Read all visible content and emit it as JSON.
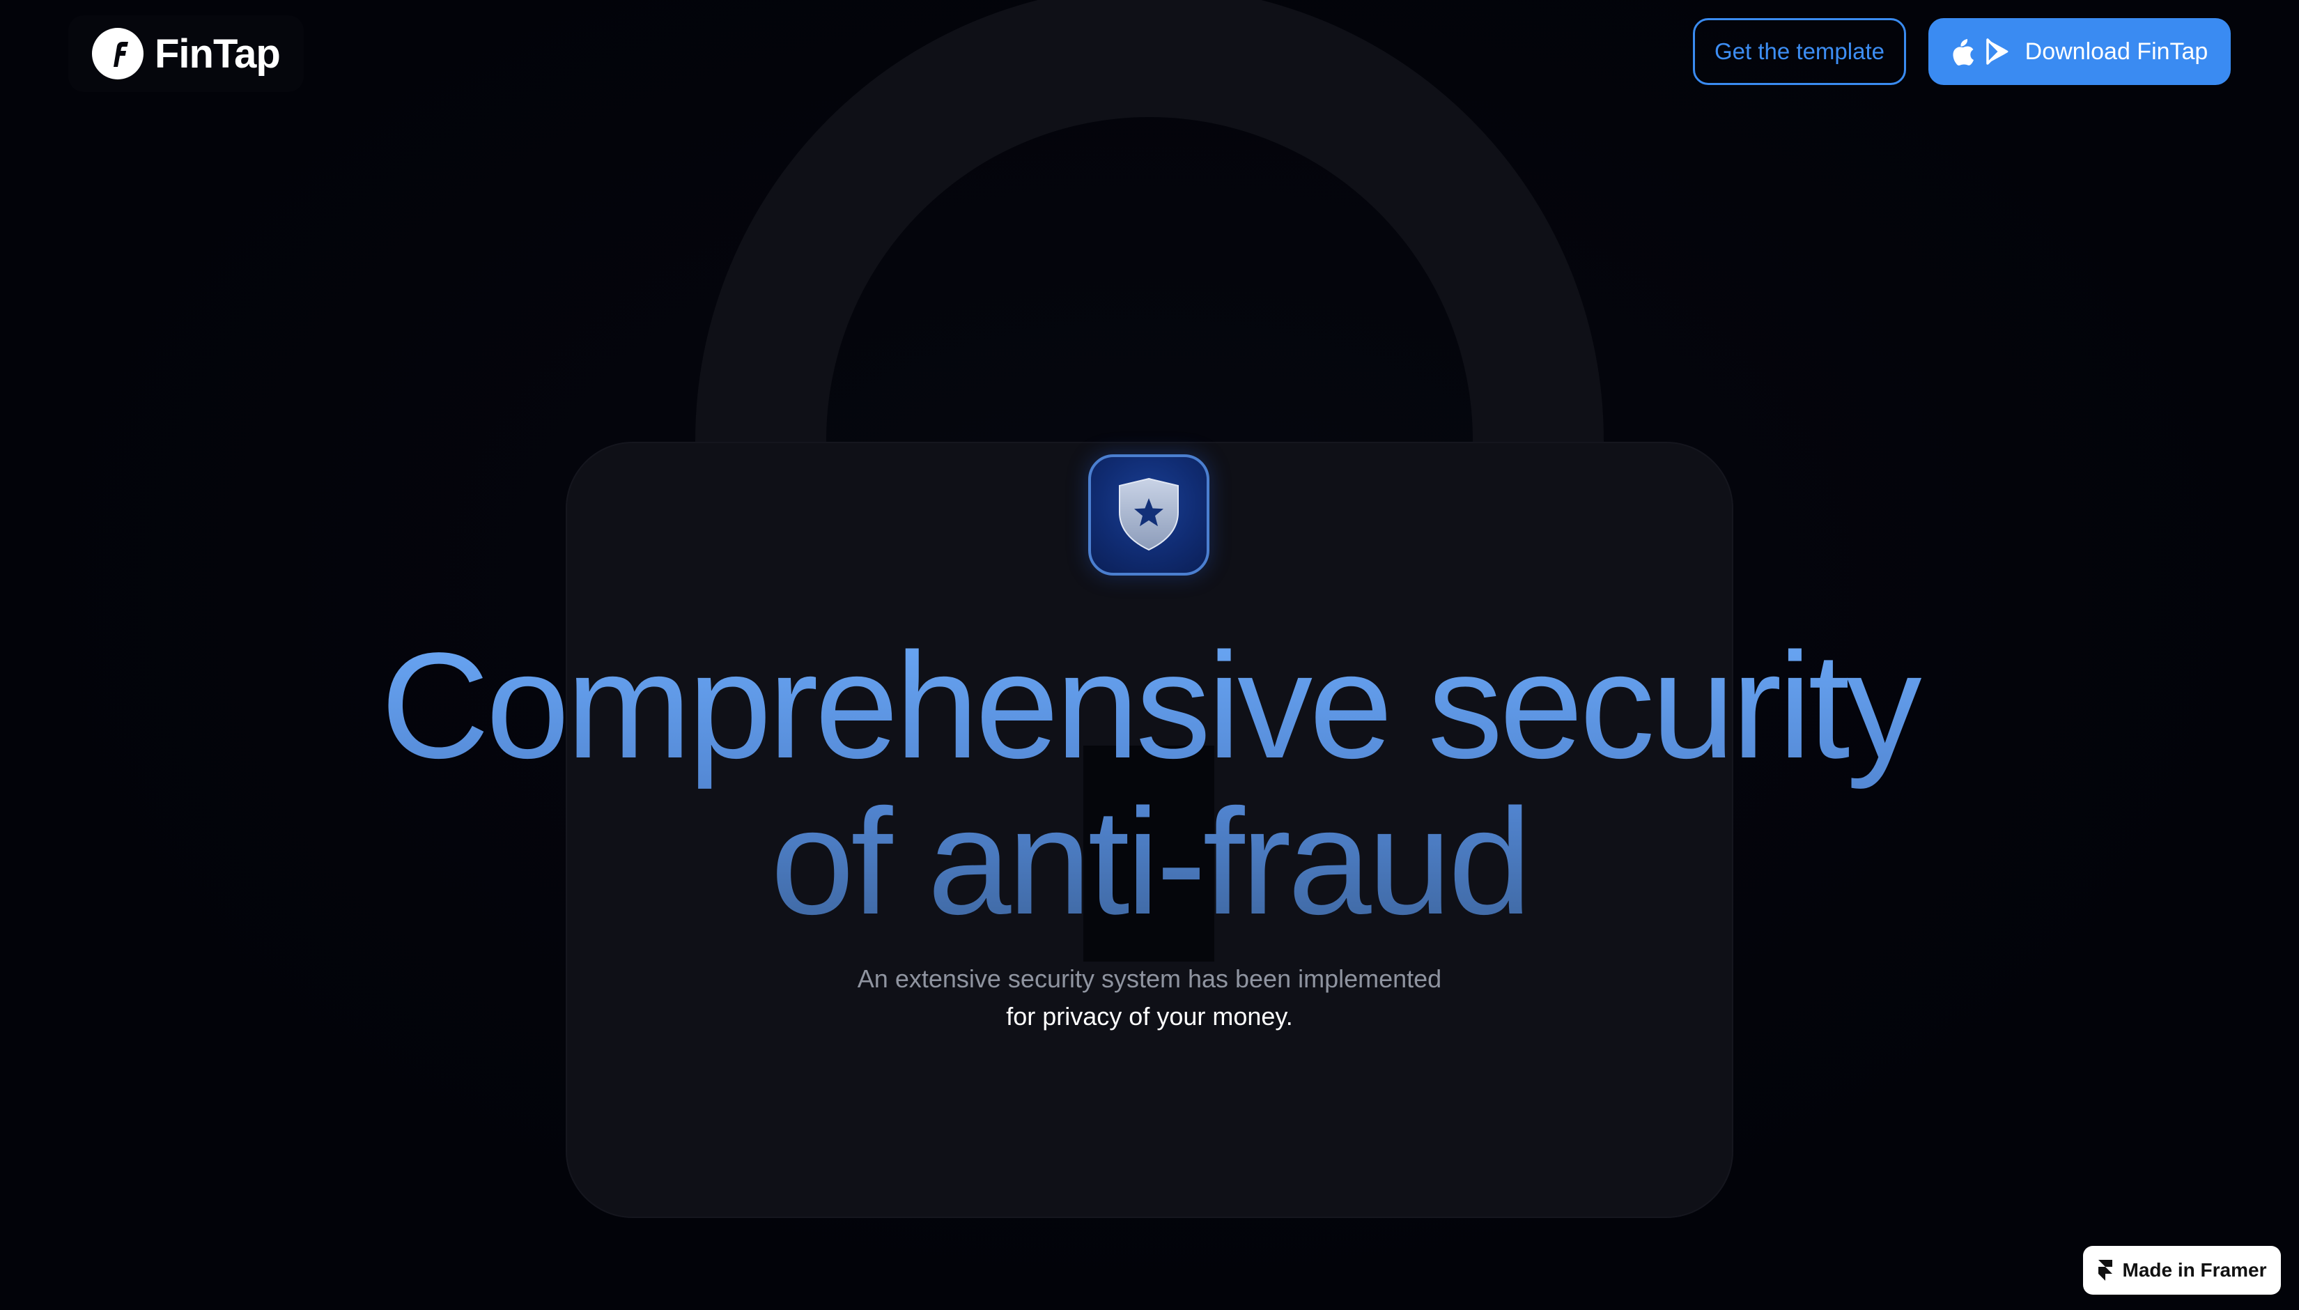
{
  "header": {
    "logo_text": "FinTap",
    "logo_icon": "fintap-f-logo-icon",
    "template_button_label": "Get the template",
    "download_button_label": "Download FinTap",
    "download_icons": [
      "apple-icon",
      "google-play-icon"
    ]
  },
  "hero": {
    "badge_icon": "shield-star-icon",
    "title_line1": "Comprehensive security",
    "title_line2": "of anti-fraud",
    "subtitle_line1": "An extensive security system has been implemented",
    "subtitle_line2": "for privacy of your money.",
    "background_icon": "padlock-icon"
  },
  "framer_badge": {
    "label": "Made in Framer",
    "icon": "framer-icon"
  },
  "colors": {
    "background": "#020309",
    "accent": "#3a8bf2",
    "title_gradient_top": "#6aa7f5",
    "title_gradient_bottom": "#3e669f",
    "subtitle_muted": "#8f94a0",
    "lock": "#0f1017"
  }
}
